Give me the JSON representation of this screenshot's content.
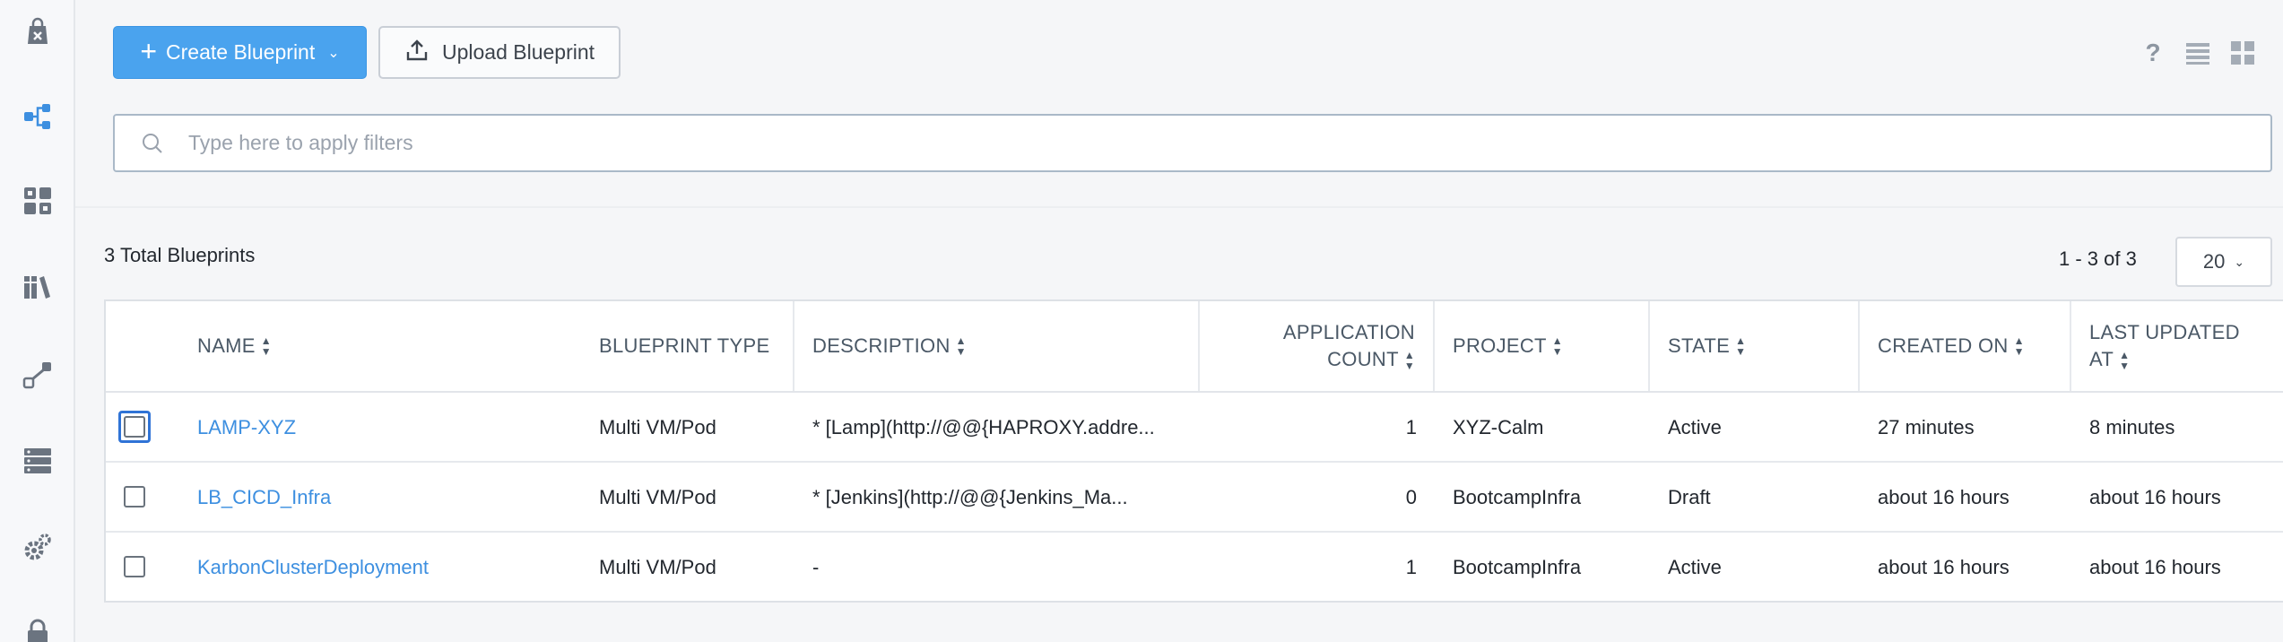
{
  "toolbar": {
    "create_label": "Create Blueprint",
    "upload_label": "Upload Blueprint"
  },
  "filter": {
    "placeholder": "Type here to apply filters"
  },
  "summary": {
    "total": "3 Total Blueprints",
    "paging": "1 - 3 of 3",
    "page_size": "20"
  },
  "table": {
    "headers": {
      "name": "NAME",
      "type": "BLUEPRINT TYPE",
      "description": "DESCRIPTION",
      "count_line1": "APPLICATION",
      "count_line2": "COUNT",
      "project": "PROJECT",
      "state": "STATE",
      "created": "CREATED ON",
      "updated_line1": "LAST UPDATED",
      "updated_line2": "AT"
    },
    "rows": [
      {
        "name": "LAMP-XYZ",
        "type": "Multi VM/Pod",
        "description": "* [Lamp](http://@@{HAPROXY.addre...",
        "count": "1",
        "project": "XYZ-Calm",
        "state": "Active",
        "created": "27 minutes",
        "updated": "8 minutes"
      },
      {
        "name": "LB_CICD_Infra",
        "type": "Multi VM/Pod",
        "description": "* [Jenkins](http://@@{Jenkins_Ma...",
        "count": "0",
        "project": "BootcampInfra",
        "state": "Draft",
        "created": "about 16 hours",
        "updated": "about 16 hours"
      },
      {
        "name": "KarbonClusterDeployment",
        "type": "Multi VM/Pod",
        "description": "-",
        "count": "1",
        "project": "BootcampInfra",
        "state": "Active",
        "created": "about 16 hours",
        "updated": "about 16 hours"
      }
    ]
  },
  "colors": {
    "accent": "#4aa3ee",
    "link": "#3d8fe0",
    "rail_active": "#3d8fe0"
  },
  "icons": {
    "rail": [
      "shopping-bag-icon",
      "blueprint-flow-icon",
      "dashboard-grid-icon",
      "library-icon",
      "runbook-icon",
      "server-stack-icon",
      "settings-gears-icon",
      "lock-icon"
    ],
    "view": [
      "help-icon",
      "list-view-icon",
      "grid-view-icon"
    ]
  }
}
